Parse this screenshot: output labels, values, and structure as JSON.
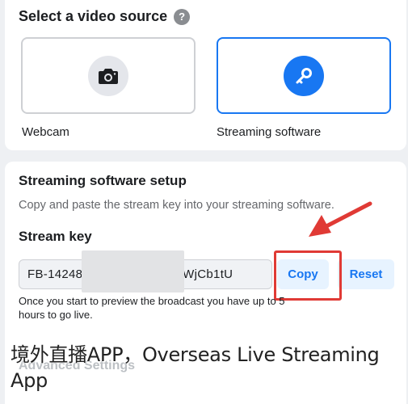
{
  "video_source": {
    "title": "Select a video source",
    "help_icon": "question-mark-icon",
    "options": [
      {
        "label": "Webcam",
        "icon": "camera-icon",
        "selected": false
      },
      {
        "label": "Streaming software",
        "icon": "key-icon",
        "selected": true
      }
    ]
  },
  "setup": {
    "title": "Streaming software setup",
    "description": "Copy and paste the stream key into your streaming software.",
    "stream_key_label": "Stream key",
    "stream_key_value": "FB-14248                    Aby1WjCb1tU",
    "copy_label": "Copy",
    "reset_label": "Reset",
    "preview_note": "Once you start to preview the broadcast you have up to 5 hours to go live.",
    "advanced_label": "Advanced Settings"
  },
  "overlay": {
    "watermark": "境外直播APP，Overseas Live Streaming App",
    "arrow_color": "#e03a35"
  },
  "colors": {
    "accent": "#1877f2",
    "annotation": "#e03a35",
    "selected_border": "#1877f2"
  }
}
